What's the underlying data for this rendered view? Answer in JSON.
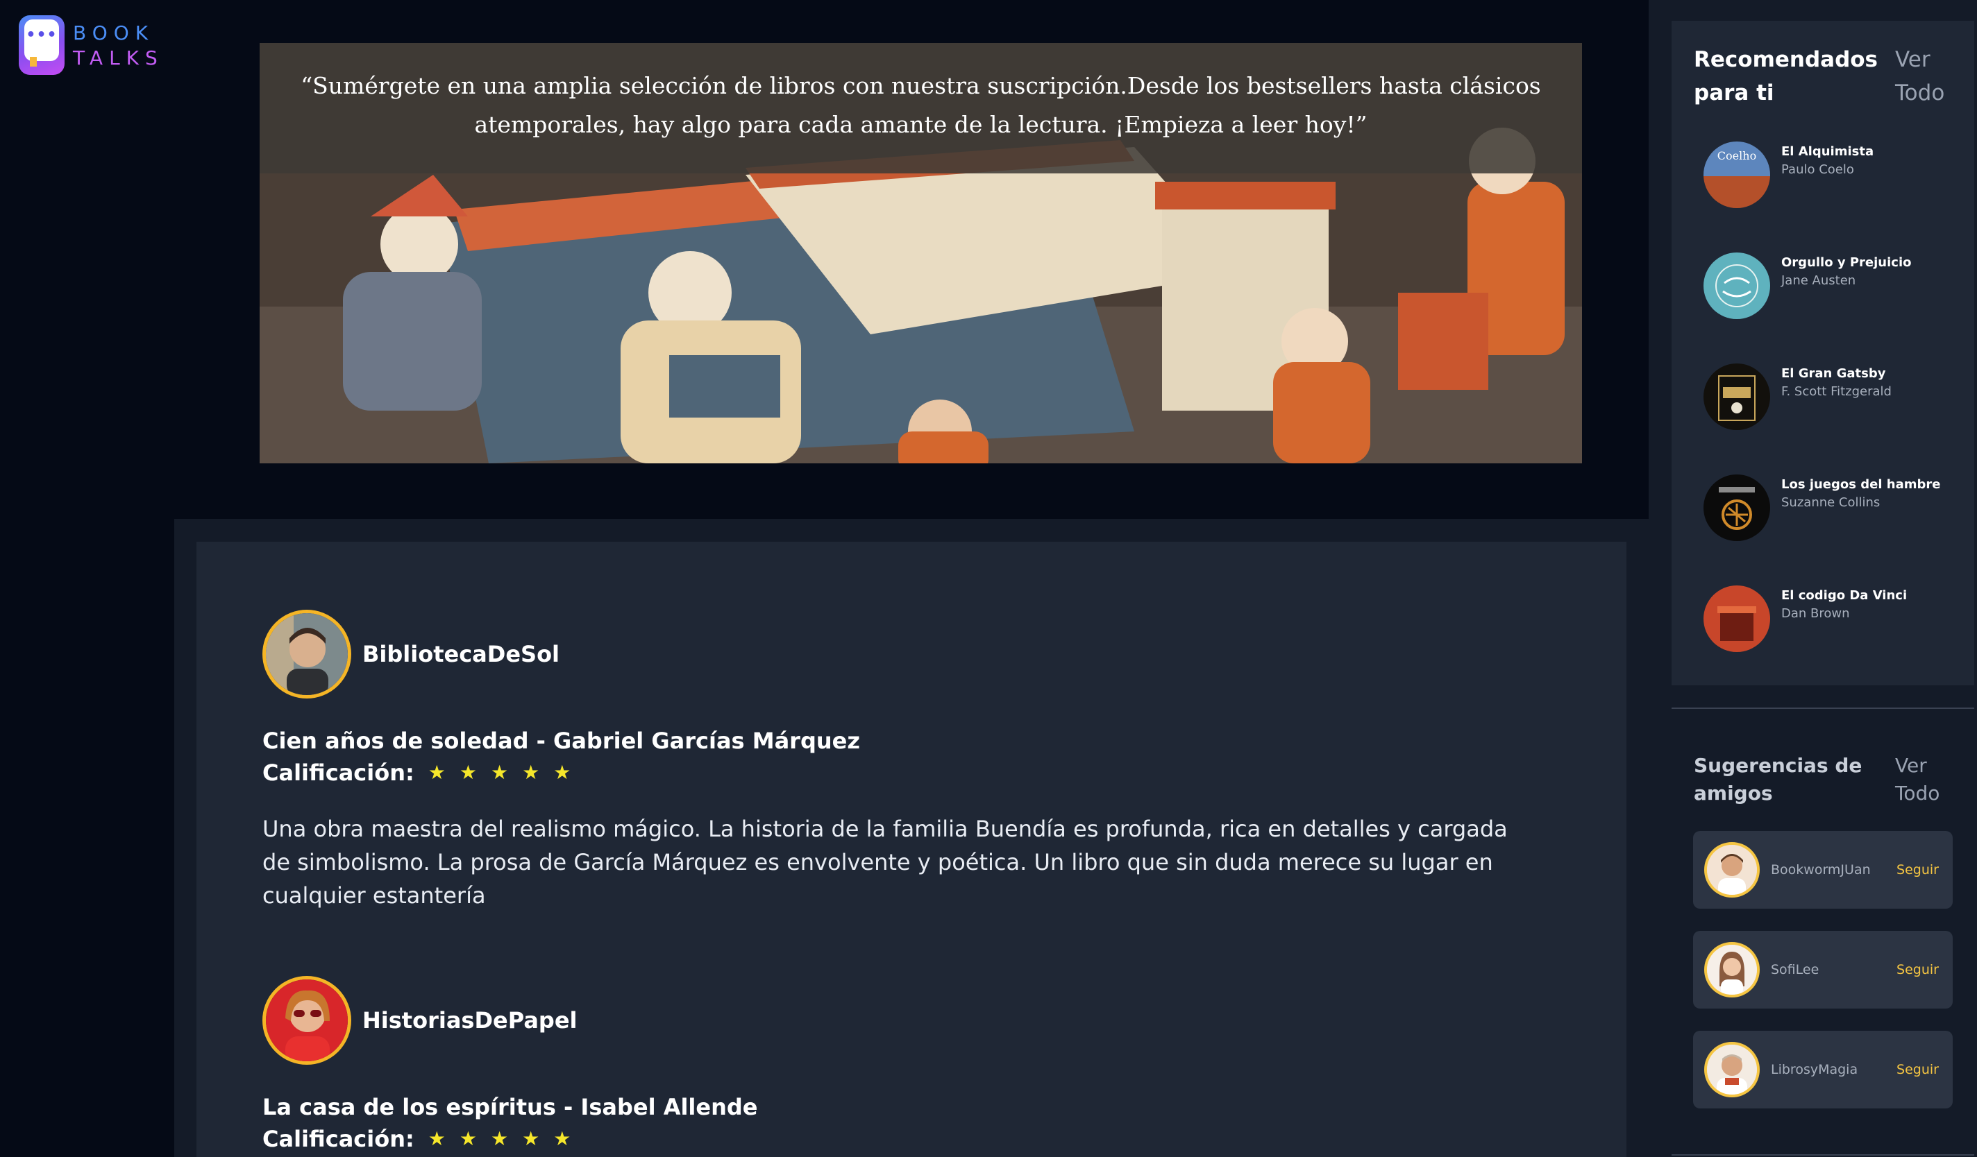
{
  "logo": {
    "line1": "BOOK",
    "line2": "TALKS",
    "icon": "chat-bubble-book-icon"
  },
  "hero": {
    "quote": "“Sumérgete en una amplia selección de libros con nuestra suscripción.Desde los bestsellers hasta clásicos atemporales, hay algo para cada amante de la lectura. ¡Empieza a leer hoy!”"
  },
  "feed": {
    "reviews": [
      {
        "author": "BibliotecaDeSol",
        "book": "Cien años de soledad - Gabriel Garcías Márquez",
        "rating_label": "Calificación:",
        "stars": 5,
        "text": "Una obra maestra del realismo mágico. La historia de la familia Buendía es profunda, rica en detalles y cargada de simbolismo. La prosa de García Márquez es envolvente y poética. Un libro que sin duda merece su lugar en cualquier estantería"
      },
      {
        "author": "HistoriasDePapel",
        "book": "La casa de los espíritus - Isabel Allende",
        "rating_label": "Calificación:",
        "stars": 5
      }
    ]
  },
  "sidebar": {
    "recommended": {
      "title": "Recomendados para ti",
      "link": "Ver Todo",
      "items": [
        {
          "title": "El Alquimista",
          "author": "Paulo Coelo"
        },
        {
          "title": "Orgullo y Prejuicio",
          "author": "Jane Austen"
        },
        {
          "title": "El Gran Gatsby",
          "author": "F. Scott Fitzgerald"
        },
        {
          "title": "Los juegos del hambre",
          "author": "Suzanne Collins"
        },
        {
          "title": "El codigo Da Vinci",
          "author": "Dan Brown"
        }
      ]
    },
    "suggestions": {
      "title": "Sugerencias de amigos",
      "link": "Ver Todo",
      "items": [
        {
          "name": "BookwormJUan",
          "action": "Seguir"
        },
        {
          "name": "SofiLee",
          "action": "Seguir"
        },
        {
          "name": "LibrosyMagia",
          "action": "Seguir"
        }
      ]
    }
  },
  "colors": {
    "background": "#050a16",
    "panel": "#1f2735",
    "accent": "#f5c542",
    "star": "#f6e72b"
  }
}
